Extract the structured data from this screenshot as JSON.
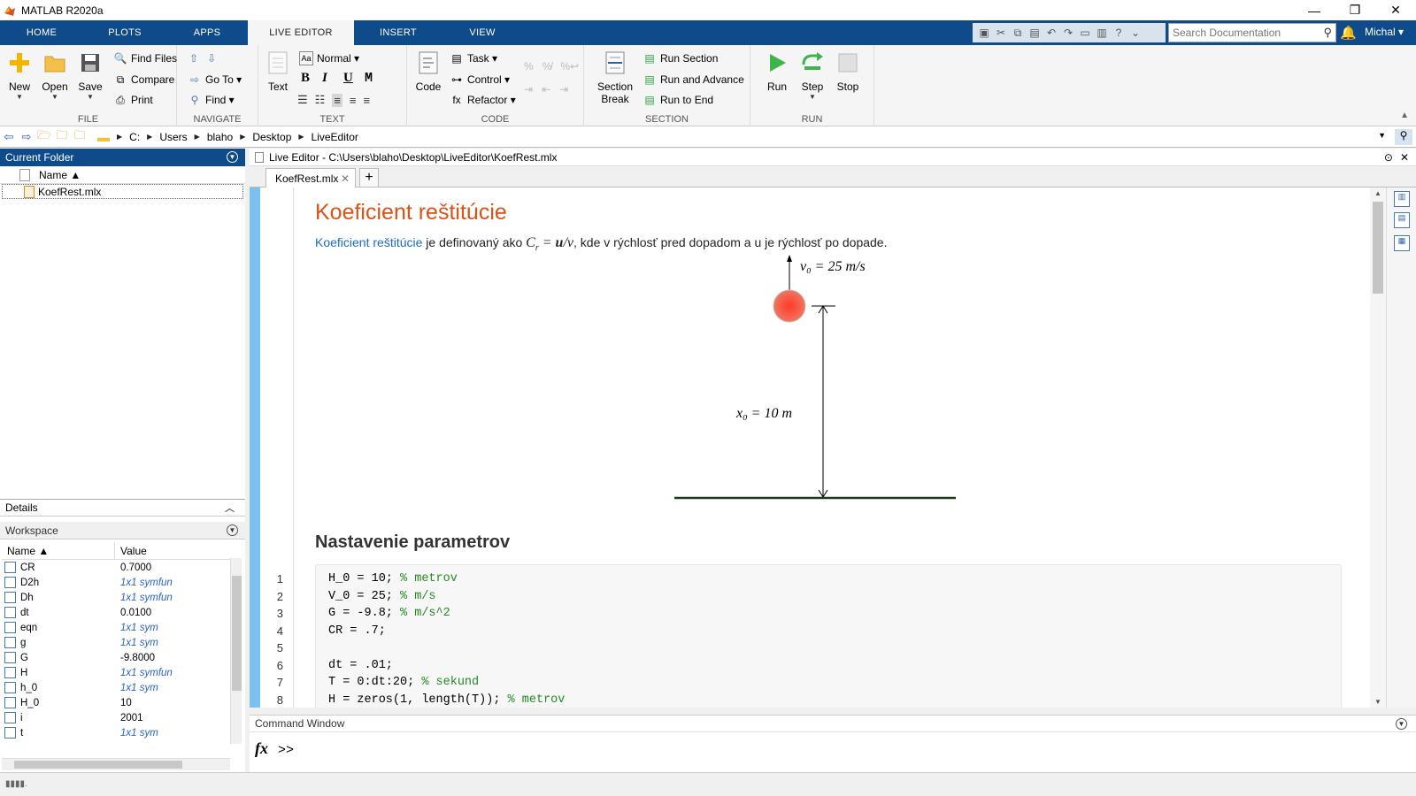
{
  "window": {
    "title": "MATLAB R2020a",
    "minimize": "—",
    "restore": "❐",
    "close": "✕"
  },
  "tabs": [
    {
      "label": "HOME"
    },
    {
      "label": "PLOTS"
    },
    {
      "label": "APPS"
    },
    {
      "label": "LIVE EDITOR",
      "active": true
    },
    {
      "label": "INSERT"
    },
    {
      "label": "VIEW"
    }
  ],
  "search": {
    "placeholder": "Search Documentation"
  },
  "user": {
    "name": "Michal"
  },
  "ribbon": {
    "file": {
      "label": "FILE",
      "new": "New",
      "open": "Open",
      "save": "Save",
      "find_files": "Find Files",
      "compare": "Compare",
      "print": "Print"
    },
    "navigate": {
      "label": "NAVIGATE",
      "go_to": "Go To",
      "find": "Find"
    },
    "text": {
      "label": "TEXT",
      "text_btn": "Text",
      "style": "Normal",
      "bold": "B",
      "italic": "I",
      "underline": "U",
      "mono": "M"
    },
    "code": {
      "label": "CODE",
      "code_btn": "Code",
      "task": "Task",
      "control": "Control",
      "refactor": "Refactor"
    },
    "section": {
      "label": "SECTION",
      "section_break_1": "Section",
      "section_break_2": "Break",
      "run_section": "Run Section",
      "run_and_advance": "Run and Advance",
      "run_to_end": "Run to End"
    },
    "run": {
      "label": "RUN",
      "run": "Run",
      "step": "Step",
      "stop": "Stop"
    }
  },
  "address": {
    "crumbs": [
      "C:",
      "Users",
      "blaho",
      "Desktop",
      "LiveEditor"
    ]
  },
  "current_folder": {
    "title": "Current Folder",
    "column_name": "Name ▲",
    "files": [
      "KoefRest.mlx"
    ]
  },
  "details": {
    "title": "Details"
  },
  "workspace": {
    "title": "Workspace",
    "col_name": "Name ▲",
    "col_value": "Value",
    "rows": [
      {
        "name": "CR",
        "value": "0.7000",
        "sym": false
      },
      {
        "name": "D2h",
        "value": "1x1 symfun",
        "sym": true
      },
      {
        "name": "Dh",
        "value": "1x1 symfun",
        "sym": true
      },
      {
        "name": "dt",
        "value": "0.0100",
        "sym": false
      },
      {
        "name": "eqn",
        "value": "1x1 sym",
        "sym": true
      },
      {
        "name": "g",
        "value": "1x1 sym",
        "sym": true
      },
      {
        "name": "G",
        "value": "-9.8000",
        "sym": false
      },
      {
        "name": "H",
        "value": "1x1 symfun",
        "sym": true
      },
      {
        "name": "h_0",
        "value": "1x1 sym",
        "sym": true
      },
      {
        "name": "H_0",
        "value": "10",
        "sym": false
      },
      {
        "name": "i",
        "value": "2001",
        "sym": false
      },
      {
        "name": "t",
        "value": "1x1 sym",
        "sym": true
      }
    ]
  },
  "editor": {
    "header": "Live Editor - C:\\Users\\blaho\\Desktop\\LiveEditor\\KoefRest.mlx",
    "doc_tab": "KoefRest.mlx",
    "heading": "Koeficient reštitúcie",
    "para_link": "Koeficient reštitúcie",
    "para_text_1": " je definovaný ako ",
    "para_math": "Cr = u/v",
    "para_text_2": ", kde v rýchlosť pred dopadom a u je rýchlosť po dopade.",
    "figure_v0": "v₀ = 25 m/s",
    "figure_x0": "x₀ = 10 m",
    "section_heading": "Nastavenie parametrov",
    "code_lines": [
      {
        "num": "1",
        "code": "H_0 = 10; ",
        "comment": "% metrov"
      },
      {
        "num": "2",
        "code": "V_0 = 25; ",
        "comment": "% m/s"
      },
      {
        "num": "3",
        "code": "G = -9.8; ",
        "comment": "% m/s^2"
      },
      {
        "num": "4",
        "code": "CR = .7;",
        "comment": ""
      },
      {
        "num": "5",
        "code": "",
        "comment": ""
      },
      {
        "num": "6",
        "code": "dt = .01;",
        "comment": ""
      },
      {
        "num": "7",
        "code": "T = 0:dt:20; ",
        "comment": "% sekund"
      },
      {
        "num": "8",
        "code": "H = zeros(1, length(T)); ",
        "comment": "% metrov"
      }
    ]
  },
  "command_window": {
    "title": "Command Window",
    "fx": "fx",
    "prompt": ">>"
  },
  "colors": {
    "tab_bar": "#0f4a8a",
    "heading": "#d95319",
    "link": "#1a6dc4",
    "comment": "#228b22",
    "ball": "#e8453c"
  }
}
